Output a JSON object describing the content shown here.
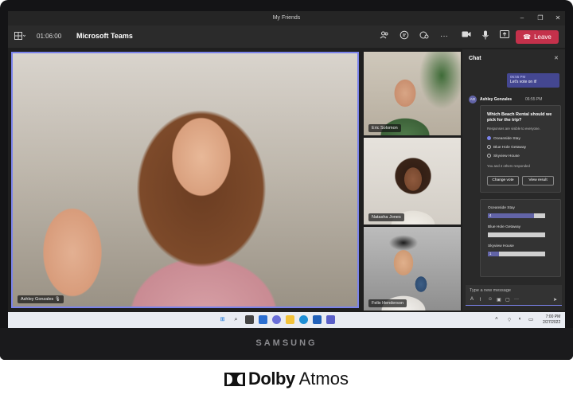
{
  "window": {
    "title": "My Friends",
    "minimize": "–",
    "maximize": "❐",
    "close": "✕"
  },
  "toolbar": {
    "layout_icon": "grid-icon",
    "call_timer": "01:06:00",
    "app_name": "Microsoft Teams",
    "icons": [
      "people-icon",
      "chat-icon",
      "reactions-icon",
      "more-icon",
      "camera-icon",
      "mic-icon",
      "share-icon"
    ],
    "leave_label": "Leave",
    "leave_color": "#c4314b"
  },
  "participants": {
    "main": "Ashley Gonzales",
    "tiles": [
      "Eric Solomon",
      "Natasha Jones",
      "Felix Henderson"
    ]
  },
  "chat": {
    "title": "Chat",
    "own_message": {
      "time": "06:55 PM",
      "text": "Let's vote on it!"
    },
    "sender": {
      "initials": "AG",
      "name": "Ashley Gonzales",
      "time": "06:55 PM"
    },
    "poll": {
      "question": "Which Beach Rental should we pick for the trip?",
      "note": "Responses are visible to everyone.",
      "options": [
        "Oceanside Stay",
        "Blue Hole Getaway",
        "Skyview House"
      ],
      "selected": 0,
      "responded": "You and 4 others responded",
      "change_vote_label": "Change vote",
      "view_result_label": "View result"
    },
    "results": [
      {
        "label": "Oceanside Stay",
        "votes": "4",
        "fraction": 0.8
      },
      {
        "label": "Blue Hole Getaway",
        "votes": "",
        "fraction": 0
      },
      {
        "label": "Skyview House",
        "votes": "1",
        "fraction": 0.2
      }
    ],
    "compose_placeholder": "Type a new message"
  },
  "taskbar": {
    "icons": [
      "start-icon",
      "search-icon",
      "task-view-icon",
      "widgets-icon",
      "chat-icon",
      "file-explorer-icon",
      "edge-icon",
      "store-icon",
      "teams-icon"
    ],
    "time": "7:00 PM",
    "date": "2/27/2022"
  },
  "device": {
    "brand": "SAMSUNG"
  },
  "logo": {
    "word1": "Dolby",
    "word2": "Atmos"
  },
  "colors": {
    "accent": "#7b83eb",
    "teams_purple": "#6264a7",
    "leave_red": "#c4314b"
  }
}
